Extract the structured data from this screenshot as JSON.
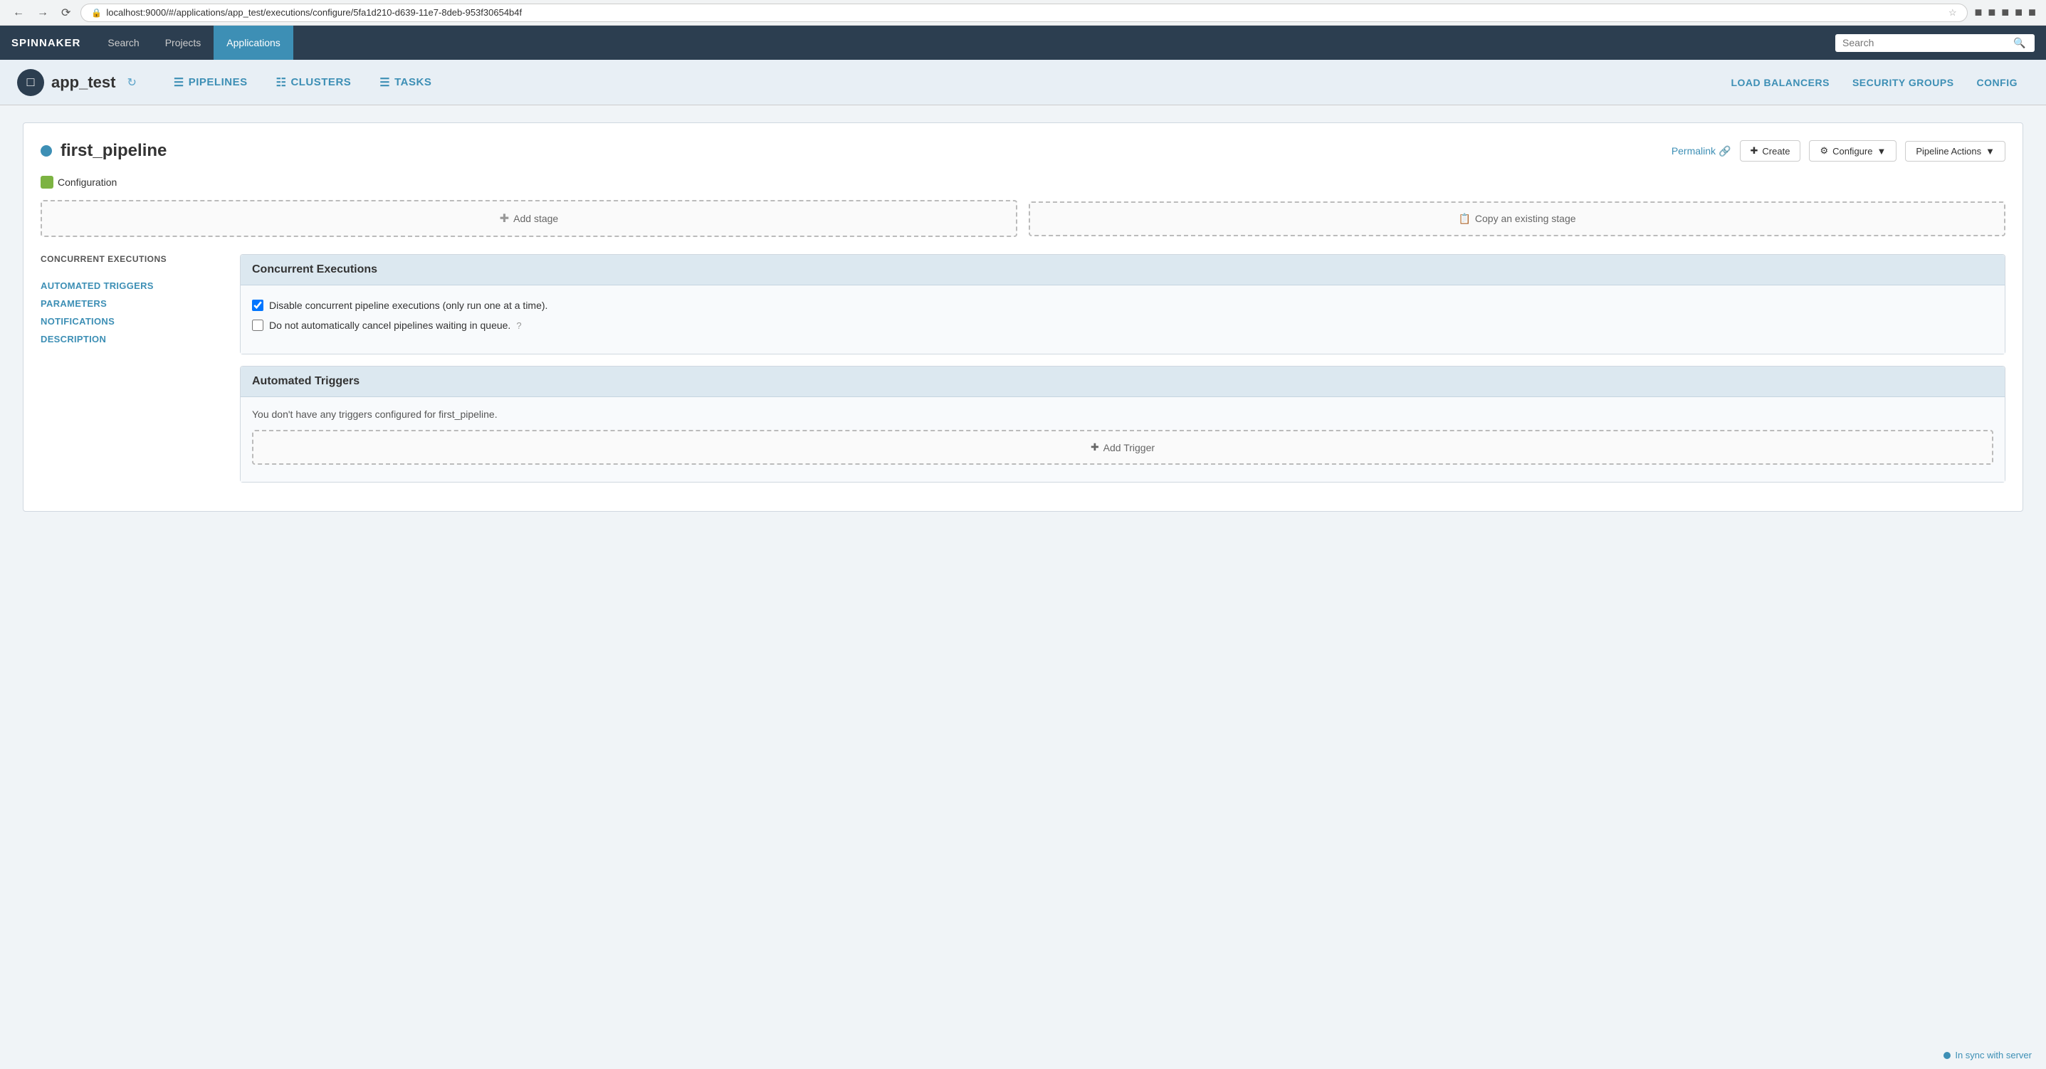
{
  "browser": {
    "url": "localhost:9000/#/applications/app_test/executions/configure/5fa1d210-d639-11e7-8deb-953f30654b4f",
    "back_title": "Back",
    "forward_title": "Forward",
    "reload_title": "Reload"
  },
  "topnav": {
    "brand": "SPINNAKER",
    "items": [
      {
        "label": "Search",
        "active": false
      },
      {
        "label": "Projects",
        "active": false
      },
      {
        "label": "Applications",
        "active": true
      }
    ],
    "search_placeholder": "Search"
  },
  "appnav": {
    "app_name": "app_test",
    "logo_letter": "□",
    "pipelines_label": "PIPELINES",
    "clusters_label": "CLUSTERS",
    "tasks_label": "TASKS",
    "load_balancers_label": "LOAD BALANCERS",
    "security_groups_label": "SECURITY GROUPS",
    "config_label": "CONFIG"
  },
  "pipeline": {
    "title": "first_pipeline",
    "permalink_label": "Permalink",
    "create_label": "Create",
    "configure_label": "Configure",
    "pipeline_actions_label": "Pipeline Actions",
    "config_section_label": "Configuration",
    "add_stage_label": "Add stage",
    "copy_stage_label": "Copy an existing stage"
  },
  "sidebar": {
    "concurrent_executions_label": "CONCURRENT EXECUTIONS",
    "links": [
      {
        "label": "AUTOMATED TRIGGERS"
      },
      {
        "label": "PARAMETERS"
      },
      {
        "label": "NOTIFICATIONS"
      },
      {
        "label": "DESCRIPTION"
      }
    ]
  },
  "concurrent_executions": {
    "section_title": "Concurrent Executions",
    "checkbox1_label": "Disable concurrent pipeline executions (only run one at a time).",
    "checkbox1_checked": true,
    "checkbox2_label": "Do not automatically cancel pipelines waiting in queue.",
    "checkbox2_checked": false
  },
  "automated_triggers": {
    "section_title": "Automated Triggers",
    "empty_message": "You don't have any triggers configured for first_pipeline.",
    "add_trigger_label": "Add Trigger"
  },
  "status": {
    "label": "In sync with server"
  }
}
